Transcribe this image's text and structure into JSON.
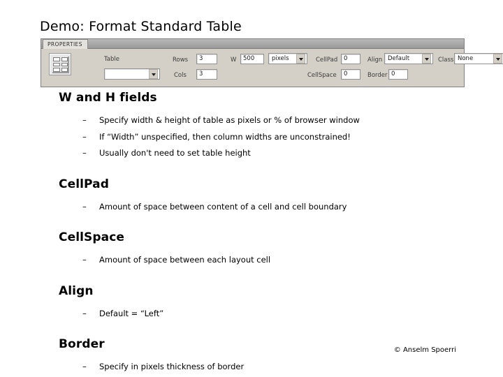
{
  "slide": {
    "title": "Demo: Format Standard Table",
    "footer": "© Anselm Spoerri"
  },
  "properties_panel": {
    "tab_label": "PROPERTIES",
    "icon_name": "table-grid-icon",
    "fields": {
      "table_label": "Table",
      "table_value": "",
      "rows_label": "Rows",
      "rows_value": "3",
      "cols_label": "Cols",
      "cols_value": "3",
      "w_label": "W",
      "w_value": "500",
      "w_unit_value": "pixels",
      "cellpad_label": "CellPad",
      "cellpad_value": "0",
      "cellspace_label": "CellSpace",
      "cellspace_value": "0",
      "align_label": "Align",
      "align_value": "Default",
      "border_label": "Border",
      "border_value": "0",
      "class_label": "Class",
      "class_value": "None"
    }
  },
  "sections": [
    {
      "heading": "W and H fields",
      "bullets": [
        "Specify width & height of table as pixels or % of browser window",
        "If “Width” unspecified, then column widths are unconstrained!",
        "Usually don't need to set table height"
      ]
    },
    {
      "heading": "CellPad",
      "bullets": [
        "Amount of space between content of a cell and cell boundary"
      ]
    },
    {
      "heading": "CellSpace",
      "bullets": [
        "Amount of space between each layout cell"
      ]
    },
    {
      "heading": "Align",
      "bullets": [
        "Default = “Left”"
      ]
    },
    {
      "heading": "Border",
      "bullets": [
        "Specify in pixels thickness of border"
      ]
    }
  ],
  "bullet_marker": "–"
}
